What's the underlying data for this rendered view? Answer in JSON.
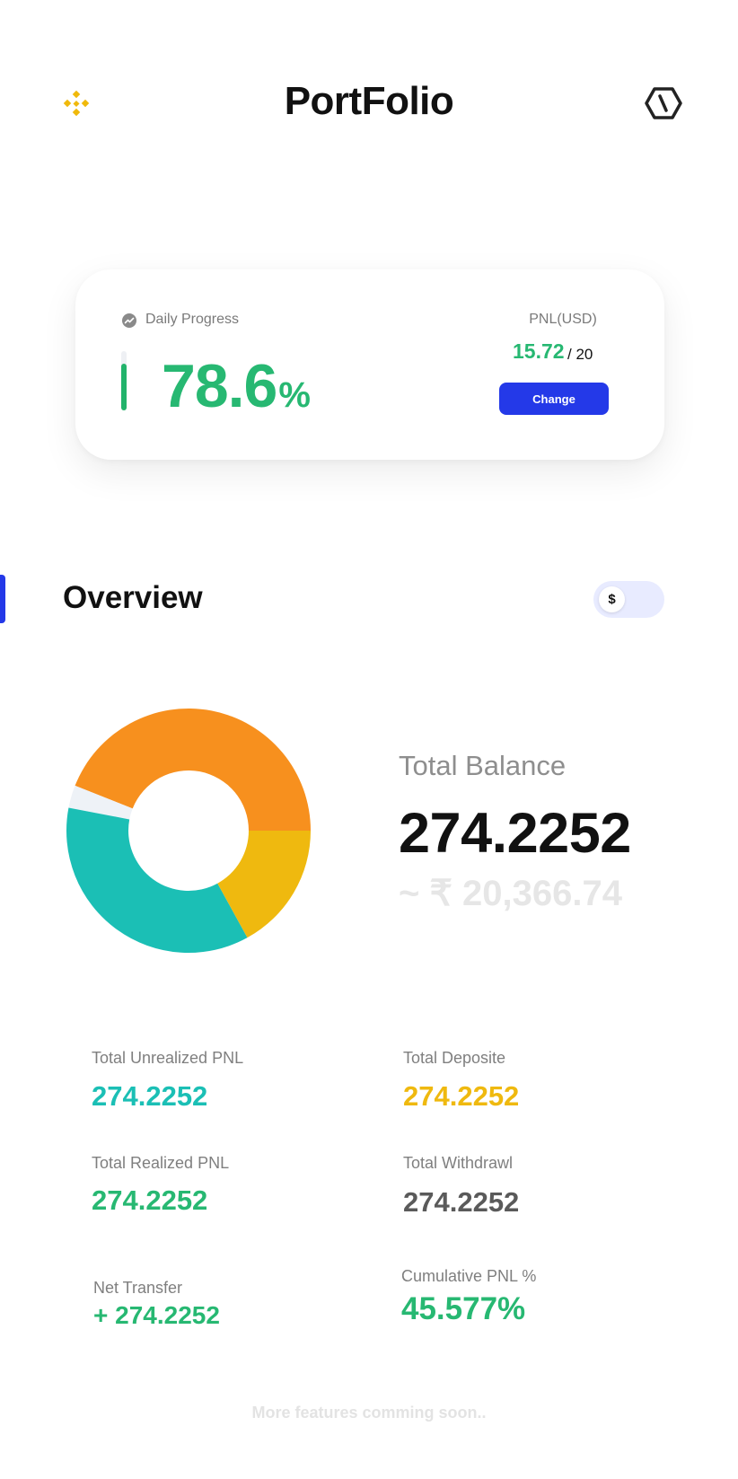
{
  "header": {
    "title": "PortFolio",
    "logo_icon": "binance-diamond-icon",
    "settings_icon": "hexagon-slash-icon",
    "brand_color": "#F0B90B"
  },
  "daily_card": {
    "label": "Daily Progress",
    "icon": "trend-icon",
    "value": "78.6",
    "unit": "%",
    "progress_fraction": 0.786,
    "pnl_label": "PNL(USD)",
    "pnl_value": "15.72",
    "pnl_total": "/ 20",
    "change_label": "Change",
    "accent": "#27B872",
    "button_color": "#2439E8"
  },
  "overview": {
    "title": "Overview",
    "currency_toggle": "$",
    "total_balance_label": "Total Balance",
    "total_balance_value": "274.2252",
    "total_balance_inr": "~ ₹ 20,366.74",
    "donut_segments": [
      {
        "color": "#F7901E",
        "fraction": 0.44
      },
      {
        "color": "#EEF2F7",
        "fraction": 0.03
      },
      {
        "color": "#1BBFB5",
        "fraction": 0.36
      },
      {
        "color": "#EFB90F",
        "fraction": 0.17
      }
    ]
  },
  "stats": [
    {
      "label": "Total Unrealized PNL",
      "value": "274.2252",
      "color": "#1BBFB5"
    },
    {
      "label": "Total Deposite",
      "value": "274.2252",
      "color": "#EFB90F"
    },
    {
      "label": "Total Realized PNL",
      "value": "274.2252",
      "color": "#27B872"
    },
    {
      "label": "Total Withdrawl",
      "value": "274.2252",
      "color": "#5A5A5A"
    },
    {
      "label": "Net Transfer",
      "value": "+ 274.2252",
      "color": "#27B872"
    },
    {
      "label": "Cumulative PNL %",
      "value": "45.577%",
      "color": "#27B872"
    }
  ],
  "footer": {
    "text": "More features comming soon.."
  }
}
